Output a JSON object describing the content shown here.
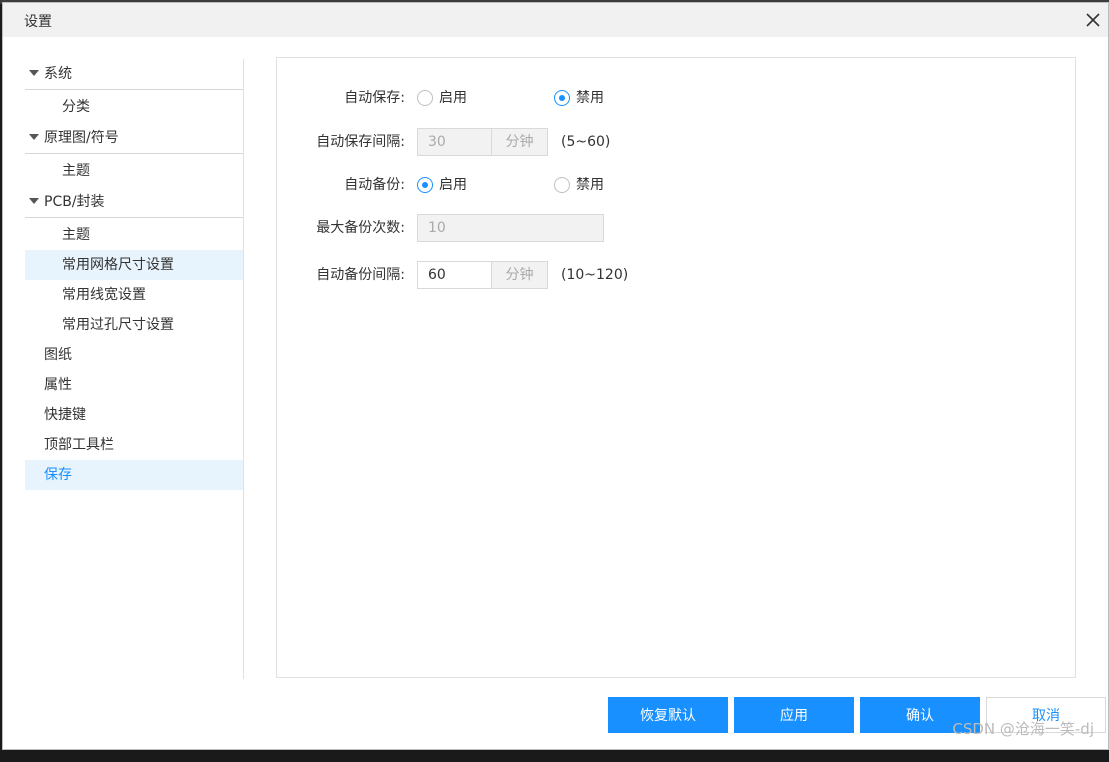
{
  "window": {
    "title": "设置"
  },
  "nav": {
    "items": [
      {
        "label": "系统"
      },
      {
        "label": "分类"
      },
      {
        "label": "原理图/符号"
      },
      {
        "label": "主题"
      },
      {
        "label": "PCB/封装"
      },
      {
        "label": "主题"
      },
      {
        "label": "常用网格尺寸设置"
      },
      {
        "label": "常用线宽设置"
      },
      {
        "label": "常用过孔尺寸设置"
      },
      {
        "label": "图纸"
      },
      {
        "label": "属性"
      },
      {
        "label": "快捷键"
      },
      {
        "label": "顶部工具栏"
      },
      {
        "label": "保存"
      }
    ],
    "selected": "保存"
  },
  "form": {
    "auto_save": {
      "label": "自动保存:",
      "enable": "启用",
      "disable": "禁用",
      "value": "禁用"
    },
    "auto_save_interval": {
      "label": "自动保存间隔:",
      "value": "30",
      "unit": "分钟",
      "range": "(5~60)"
    },
    "auto_backup": {
      "label": "自动备份:",
      "enable": "启用",
      "disable": "禁用",
      "value": "启用"
    },
    "max_backups": {
      "label": "最大备份次数:",
      "value": "10"
    },
    "auto_backup_interval": {
      "label": "自动备份间隔:",
      "value": "60",
      "unit": "分钟",
      "range": "(10~120)"
    }
  },
  "footer": {
    "restore_default": "恢复默认",
    "apply": "应用",
    "confirm": "确认",
    "cancel": "取消"
  },
  "watermark": "CSDN @沧海一笑-dj",
  "colors": {
    "accent": "#1890ff",
    "selected_bg": "#e8f4fd"
  }
}
